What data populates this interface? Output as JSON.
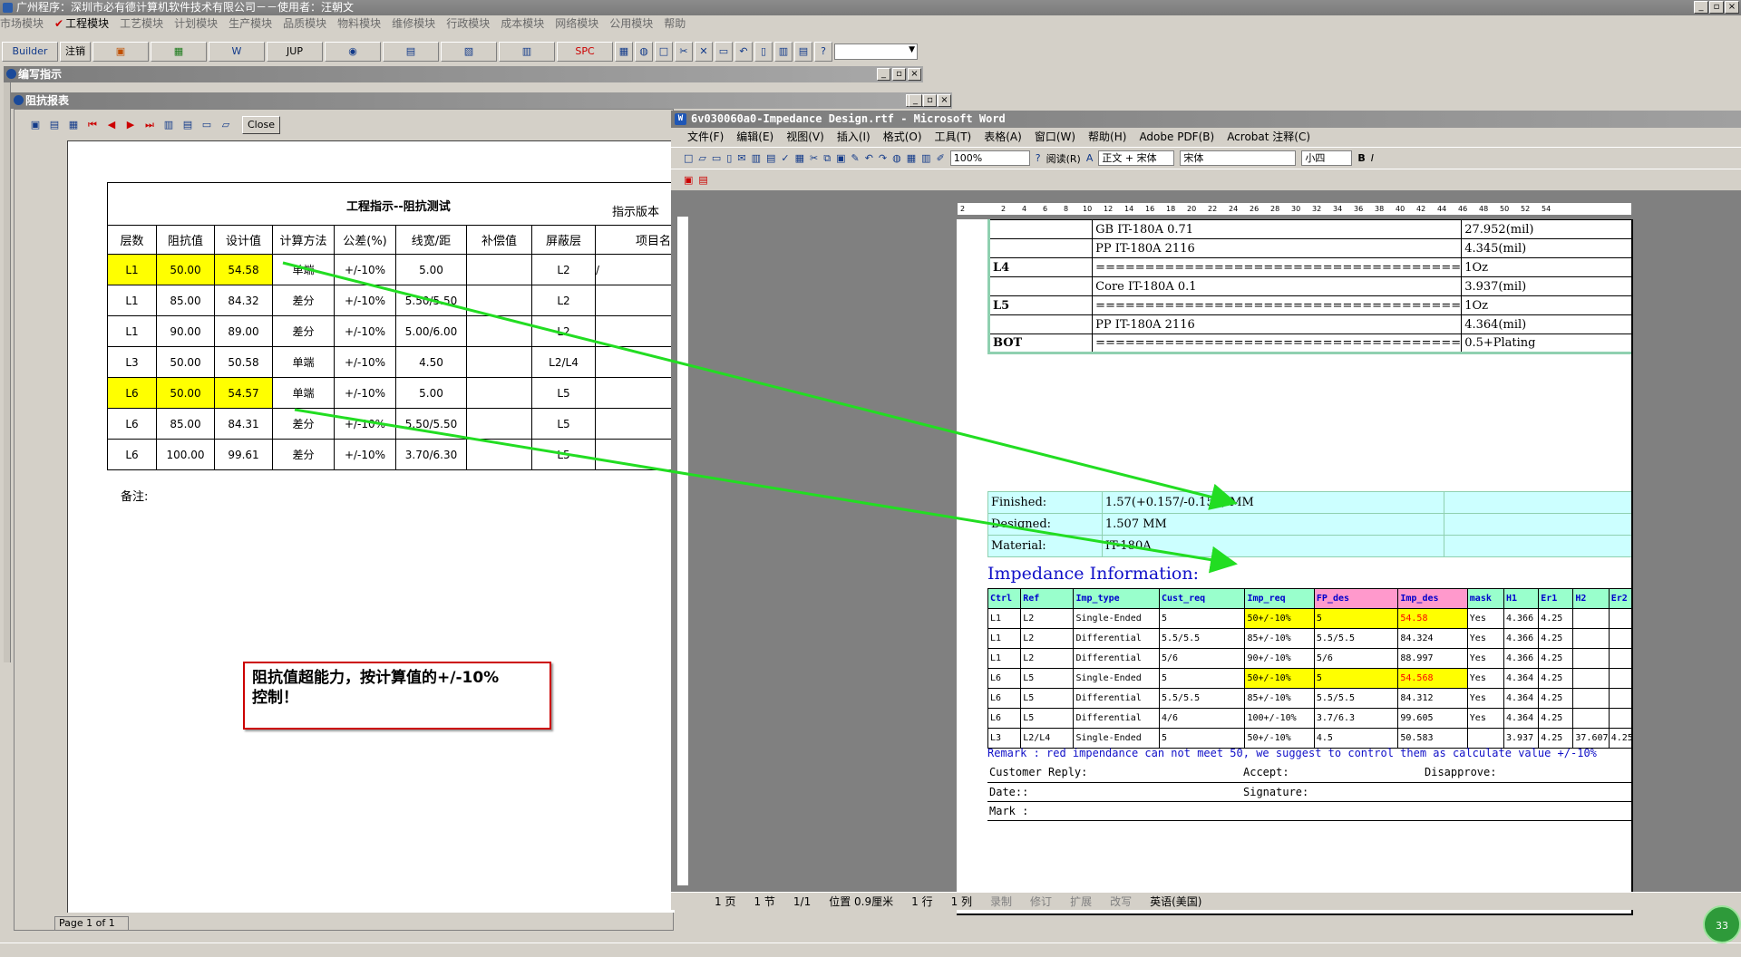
{
  "app_title": "广州程序：深圳市必有德计算机软件技术有限公司－－使用者：汪朝文",
  "menu": {
    "items": [
      "市场模块",
      "工程模块",
      "工艺模块",
      "计划模块",
      "生产模块",
      "品质模块",
      "物料模块",
      "维修模块",
      "行政模块",
      "成本模块",
      "网络模块",
      "公用模块",
      "帮助"
    ]
  },
  "toolbar": {
    "builder": "Builder",
    "logout": "注销",
    "jup": "JUP",
    "spc": "SPC"
  },
  "windows": {
    "work_instruction": "编写指示",
    "impedance_report": "阻抗报表"
  },
  "report": {
    "close": "Close",
    "title": "工程指示--阻抗测试",
    "version": "指示版本",
    "headers": [
      "层数",
      "阻抗值",
      "设计值",
      "计算方法",
      "公差(%)",
      "线宽/距",
      "补偿值",
      "屏蔽层",
      "项目名"
    ],
    "rows": [
      [
        "L1",
        "50.00",
        "54.58",
        "单端",
        "+/-10%",
        "5.00",
        "",
        "L2",
        "/"
      ],
      [
        "L1",
        "85.00",
        "84.32",
        "差分",
        "+/-10%",
        "5.50/5.50",
        "",
        "L2",
        ""
      ],
      [
        "L1",
        "90.00",
        "89.00",
        "差分",
        "+/-10%",
        "5.00/6.00",
        "",
        "L2",
        ""
      ],
      [
        "L3",
        "50.00",
        "50.58",
        "单端",
        "+/-10%",
        "4.50",
        "",
        "L2/L4",
        ""
      ],
      [
        "L6",
        "50.00",
        "54.57",
        "单端",
        "+/-10%",
        "5.00",
        "",
        "L5",
        ""
      ],
      [
        "L6",
        "85.00",
        "84.31",
        "差分",
        "+/-10%",
        "5.50/5.50",
        "",
        "L5",
        ""
      ],
      [
        "L6",
        "100.00",
        "99.61",
        "差分",
        "+/-10%",
        "3.70/6.30",
        "",
        "L5",
        ""
      ]
    ],
    "remark": "备注:",
    "page": "Page 1 of 1"
  },
  "callout": {
    "line1": "阻抗值超能力，按计算值的+/-10%",
    "line2": "控制！"
  },
  "word": {
    "title": "6v030060a0-Impedance Design.rtf - Microsoft Word",
    "menu": [
      "文件(F)",
      "编辑(E)",
      "视图(V)",
      "插入(I)",
      "格式(O)",
      "工具(T)",
      "表格(A)",
      "窗口(W)",
      "帮助(H)",
      "Adobe PDF(B)",
      "Acrobat 注释(C)"
    ],
    "zoom": "100%",
    "read": "阅读(R)",
    "style": "正文 + 宋体",
    "font": "宋体",
    "size": "小四",
    "ruler": [
      "2",
      "2",
      "4",
      "6",
      "8",
      "10",
      "12",
      "14",
      "16",
      "18",
      "20",
      "22",
      "24",
      "26",
      "28",
      "30",
      "32",
      "34",
      "36",
      "38",
      "40",
      "42",
      "44",
      "46",
      "48",
      "50",
      "52",
      "54"
    ],
    "stack": [
      [
        "",
        "GB    IT-180A    0.71",
        "27.952(mil)"
      ],
      [
        "",
        "PP    IT-180A    2116",
        "4.345(mil)"
      ],
      [
        "L4",
        "=====================================",
        "1Oz"
      ],
      [
        "",
        "Core    IT-180A    0.1",
        "3.937(mil)"
      ],
      [
        "L5",
        "=====================================",
        "1Oz"
      ],
      [
        "",
        "PP    IT-180A    2116",
        "4.364(mil)"
      ],
      [
        "BOT",
        "=====================================",
        "0.5+Plating"
      ]
    ],
    "finished": [
      [
        "Finished:",
        "1.57(+0.157/-0.157) MM",
        ""
      ],
      [
        "Designed:",
        "1.507 MM",
        ""
      ],
      [
        "Material:",
        "IT-180A",
        ""
      ]
    ],
    "imp_title": "Impedance Information:",
    "imp_headers": [
      "Ctrl",
      "Ref",
      "Imp_type",
      "Cust_req",
      "Imp_req",
      "FP_des",
      "Imp_des",
      "mask",
      "H1",
      "Er1",
      "H2",
      "Er2"
    ],
    "imp_rows": [
      [
        "L1",
        "L2",
        "Single-Ended",
        "5",
        "50+/-10%",
        "5",
        "54.58",
        "Yes",
        "4.366",
        "4.25",
        "",
        ""
      ],
      [
        "L1",
        "L2",
        "Differential",
        "5.5/5.5",
        "85+/-10%",
        "5.5/5.5",
        "84.324",
        "Yes",
        "4.366",
        "4.25",
        "",
        ""
      ],
      [
        "L1",
        "L2",
        "Differential",
        "5/6",
        "90+/-10%",
        "5/6",
        "88.997",
        "Yes",
        "4.366",
        "4.25",
        "",
        ""
      ],
      [
        "L6",
        "L5",
        "Single-Ended",
        "5",
        "50+/-10%",
        "5",
        "54.568",
        "Yes",
        "4.364",
        "4.25",
        "",
        ""
      ],
      [
        "L6",
        "L5",
        "Differential",
        "5.5/5.5",
        "85+/-10%",
        "5.5/5.5",
        "84.312",
        "Yes",
        "4.364",
        "4.25",
        "",
        ""
      ],
      [
        "L6",
        "L5",
        "Differential",
        "4/6",
        "100+/-10%",
        "3.7/6.3",
        "99.605",
        "Yes",
        "4.364",
        "4.25",
        "",
        ""
      ],
      [
        "L3",
        "L2/L4",
        "Single-Ended",
        "5",
        "50+/-10%",
        "4.5",
        "50.583",
        "",
        "3.937",
        "4.25",
        "37.607",
        "4.25"
      ]
    ],
    "remark": "Remark : red impendance can not meet 50, we suggest to control them as calculate value +/-10%",
    "reply": {
      "customer": "Customer Reply:",
      "accept": "Accept:",
      "disapprove": "Disapprove:",
      "date": "Date::",
      "signature": "Signature:",
      "mark": "Mark :"
    },
    "status": {
      "page": "1 页",
      "section": "1 节",
      "pages": "1/1",
      "pos": "位置 0.9厘米",
      "line": "1 行",
      "col": "1 列",
      "rec": "录制",
      "rev": "修订",
      "ext": "扩展",
      "ovr": "改写",
      "lang": "英语(美国)"
    }
  },
  "badge": "33",
  "colors": {
    "highlight": "#ffff00",
    "arrow": "#22dd22",
    "callout_border": "#cc0000",
    "link_blue": "#1010c8"
  }
}
